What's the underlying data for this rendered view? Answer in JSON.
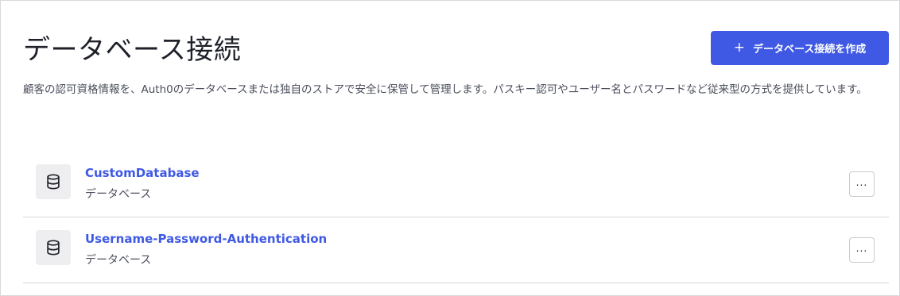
{
  "header": {
    "title": "データベース接続",
    "create_button": {
      "icon": "plus-icon",
      "icon_glyph": "+",
      "label": "データベース接続を作成"
    }
  },
  "description": "顧客の認可資格情報を、Auth0のデータベースまたは独自のストアで安全に保管して管理します。パスキー認可やユーザー名とパスワードなど従来型の方式を提供しています。",
  "connections": [
    {
      "name": "CustomDatabase",
      "type": "データベース",
      "icon": "database-icon",
      "menu_glyph": "..."
    },
    {
      "name": "Username-Password-Authentication",
      "type": "データベース",
      "icon": "database-icon",
      "menu_glyph": "..."
    }
  ],
  "colors": {
    "accent": "#3f59e4",
    "text": "#1e212a",
    "muted": "#4b4f5c",
    "divider": "#d9d9de",
    "icon_bg": "#eeeef0"
  }
}
